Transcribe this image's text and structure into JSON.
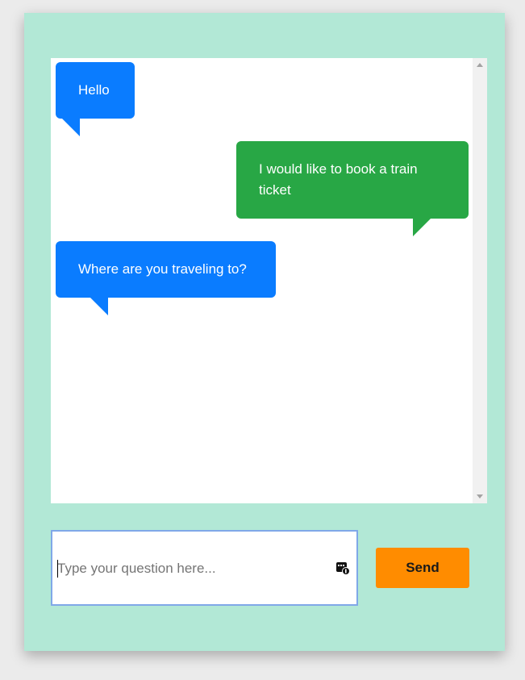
{
  "chat": {
    "messages": [
      {
        "sender": "bot",
        "text": "Hello"
      },
      {
        "sender": "user",
        "text": "I would like to book a train ticket"
      },
      {
        "sender": "bot",
        "text": "Where are you traveling to?"
      }
    ]
  },
  "composer": {
    "placeholder": "Type your question here...",
    "value": "",
    "send_label": "Send",
    "extension_icon": "extension-badge-icon"
  },
  "colors": {
    "background": "#b2e8d6",
    "bot_bubble": "#0a7cff",
    "user_bubble": "#28a745",
    "send_button": "#ff8c00"
  }
}
